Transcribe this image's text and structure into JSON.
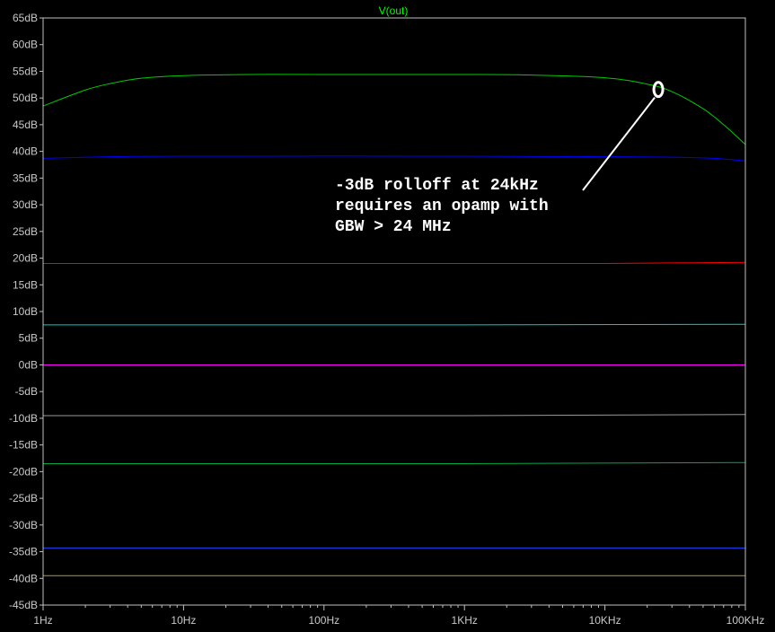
{
  "chart_data": {
    "type": "line",
    "title": "V(out)",
    "xscale": "log",
    "xlim": [
      1,
      100000
    ],
    "ylim": [
      -45,
      65
    ],
    "x_ticks": [
      1,
      10,
      100,
      1000,
      10000,
      100000
    ],
    "x_tick_labels": [
      "1Hz",
      "10Hz",
      "100Hz",
      "1KHz",
      "10KHz",
      "100KHz"
    ],
    "y_ticks": [
      65,
      60,
      55,
      50,
      45,
      40,
      35,
      30,
      25,
      20,
      15,
      10,
      5,
      0,
      -5,
      -10,
      -15,
      -20,
      -25,
      -30,
      -35,
      -40,
      -45
    ],
    "y_tick_labels": [
      "65dB",
      "60dB",
      "55dB",
      "50dB",
      "45dB",
      "40dB",
      "35dB",
      "30dB",
      "25dB",
      "20dB",
      "15dB",
      "10dB",
      "5dB",
      "0dB",
      "-5dB",
      "-10dB",
      "-15dB",
      "-20dB",
      "-25dB",
      "-30dB",
      "-35dB",
      "-40dB",
      "-45dB"
    ],
    "grid": false,
    "series": [
      {
        "color": "#00cc00",
        "x": [
          1,
          2,
          3,
          5,
          10,
          30,
          100,
          1000,
          3000,
          10000,
          20000,
          30000,
          50000,
          70000,
          100000
        ],
        "y": [
          48.5,
          51.5,
          52.7,
          53.7,
          54.2,
          54.4,
          54.4,
          54.4,
          54.3,
          53.8,
          52.6,
          51.2,
          48.0,
          45.0,
          41.3
        ]
      },
      {
        "color": "#0000ff",
        "x": [
          1,
          3,
          10,
          1000,
          10000,
          30000,
          60000,
          100000
        ],
        "y": [
          38.7,
          39.0,
          39.1,
          39.1,
          39.0,
          38.9,
          38.7,
          38.2
        ]
      },
      {
        "color": "#ff0000",
        "x": [
          1,
          100,
          10000,
          100000
        ],
        "y": [
          19.0,
          19.0,
          19.0,
          19.2
        ]
      },
      {
        "color": "#00cccc",
        "x": [
          1,
          1000,
          100000
        ],
        "y": [
          7.5,
          7.5,
          7.6
        ]
      },
      {
        "color": "#ff00ff",
        "x": [
          1,
          1000,
          100000
        ],
        "y": [
          0.0,
          0.0,
          0.0
        ]
      },
      {
        "color": "#9a9a9a",
        "x": [
          1,
          1000,
          100000
        ],
        "y": [
          -9.5,
          -9.5,
          -9.3
        ]
      },
      {
        "color": "#00aa44",
        "x": [
          1,
          1000,
          100000
        ],
        "y": [
          -18.5,
          -18.5,
          -18.3
        ]
      },
      {
        "color": "#2244ff",
        "x": [
          1,
          1000,
          100000
        ],
        "y": [
          -34.3,
          -34.3,
          -34.3
        ]
      },
      {
        "color": "#b39a3c",
        "x": [
          1,
          1000,
          100000
        ],
        "y": [
          -39.5,
          -39.5,
          -39.5
        ]
      }
    ],
    "annotation": {
      "lines": [
        "-3dB rolloff at 24kHz",
        "requires an opamp with",
        "GBW > 24 MHz"
      ],
      "marker": {
        "x": 24000,
        "y": 51.6
      }
    }
  }
}
